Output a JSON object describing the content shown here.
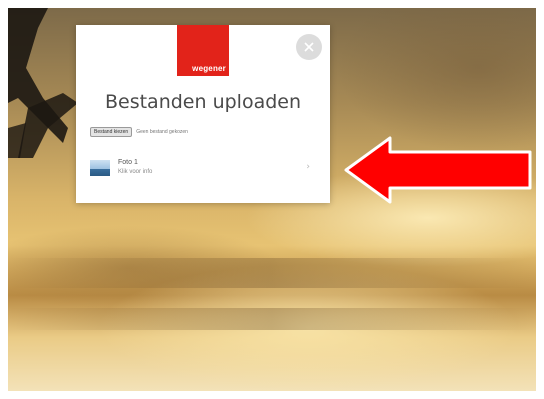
{
  "dialog": {
    "logo_text": "wegener",
    "title": "Bestanden uploaden",
    "choose_button": "Bestand kiezen",
    "choose_status": "Geen bestand gekozen",
    "close_icon": "close-icon"
  },
  "file": {
    "name": "Foto 1",
    "size": "Klik voor info",
    "action_icon": "chevron-right-icon"
  },
  "colors": {
    "brand": "#e2231a",
    "arrow": "#ff0000"
  }
}
